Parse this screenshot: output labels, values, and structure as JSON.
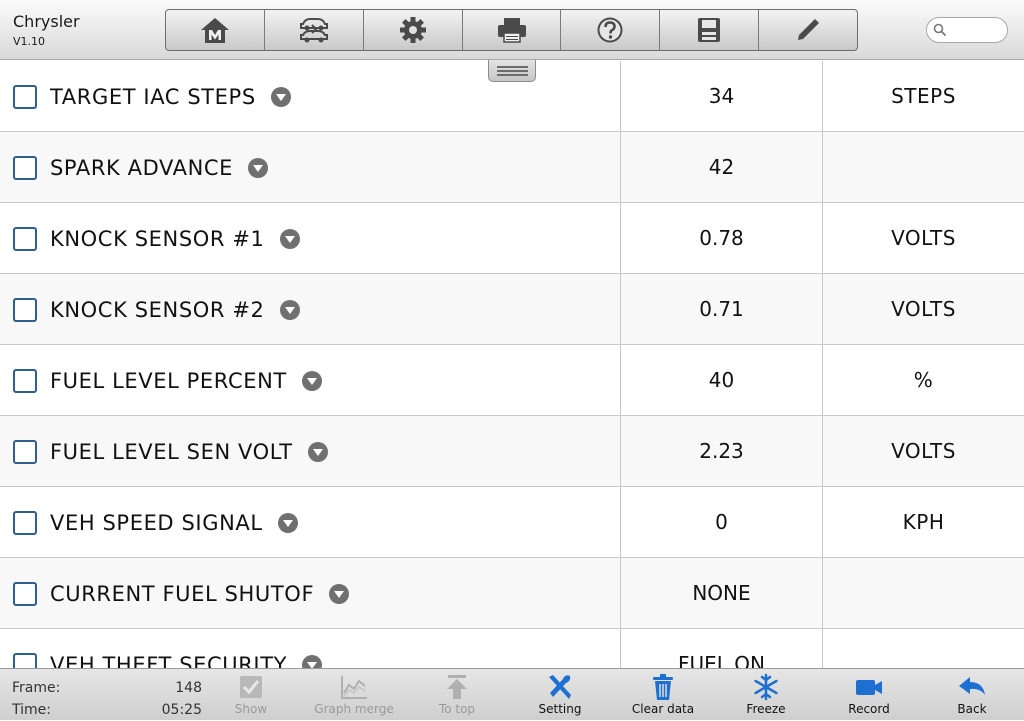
{
  "header": {
    "app_name": "Chrysler",
    "version": "V1.10",
    "toolbar": [
      {
        "name": "home",
        "icon": "home-icon"
      },
      {
        "name": "vehicle-swap",
        "icon": "car-swap-icon"
      },
      {
        "name": "settings",
        "icon": "gear-icon"
      },
      {
        "name": "print",
        "icon": "printer-icon"
      },
      {
        "name": "help",
        "icon": "help-icon"
      },
      {
        "name": "save",
        "icon": "floppy-disk-icon"
      },
      {
        "name": "edit",
        "icon": "pencil-icon"
      }
    ],
    "search": {
      "placeholder": "",
      "value": "",
      "icon": "search-icon"
    }
  },
  "rows": [
    {
      "name": "TARGET IAC STEPS",
      "value": "34",
      "unit": "STEPS"
    },
    {
      "name": "SPARK ADVANCE",
      "value": "42",
      "unit": ""
    },
    {
      "name": "KNOCK SENSOR #1",
      "value": "0.78",
      "unit": "VOLTS"
    },
    {
      "name": "KNOCK SENSOR #2",
      "value": "0.71",
      "unit": "VOLTS"
    },
    {
      "name": "FUEL LEVEL PERCENT",
      "value": "40",
      "unit": "%"
    },
    {
      "name": "FUEL LEVEL SEN VOLT",
      "value": "2.23",
      "unit": "VOLTS"
    },
    {
      "name": "VEH SPEED SIGNAL",
      "value": "0",
      "unit": "KPH"
    },
    {
      "name": "CURRENT FUEL SHUTOF",
      "value": "NONE",
      "unit": ""
    },
    {
      "name": "VEH THEFT SECURITY",
      "value": "FUEL ON",
      "unit": ""
    }
  ],
  "footer": {
    "frame_label": "Frame:",
    "frame_value": "148",
    "time_label": "Time:",
    "time_value": "05:25",
    "buttons": {
      "show": "Show",
      "graph_merge": "Graph merge",
      "to_top": "To top",
      "setting": "Setting",
      "clear_data": "Clear data",
      "freeze": "Freeze",
      "record": "Record",
      "back": "Back"
    }
  },
  "colors": {
    "accent_blue": "#1d6fd1",
    "checkbox_border": "#2f5f8a",
    "disabled_gray": "#9a9a9a"
  }
}
